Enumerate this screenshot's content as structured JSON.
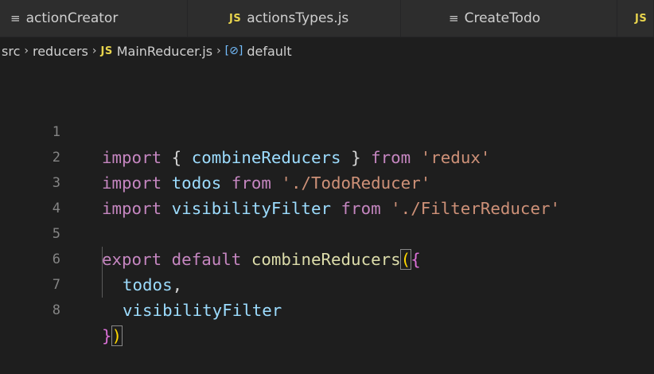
{
  "tabs": [
    {
      "icon": "≡",
      "label": "actionCreator"
    },
    {
      "icon": "JS",
      "label": "actionsTypes.js"
    },
    {
      "icon": "≡",
      "label": "CreateTodo"
    },
    {
      "icon": "JS",
      "label": ""
    }
  ],
  "breadcrumb": {
    "folder1": "src",
    "folder2": "reducers",
    "file_icon": "JS",
    "file": "MainReducer.js",
    "symbol_icon": "[⊘]",
    "symbol": "default",
    "separator": "›"
  },
  "editor": {
    "line_numbers": [
      "1",
      "2",
      "3",
      "4",
      "5",
      "6",
      "7",
      "8"
    ],
    "tokens": {
      "import": "import",
      "from": "from",
      "export": "export",
      "default": "default",
      "combineReducers": "combineReducers",
      "todos": "todos",
      "visibilityFilter": "visibilityFilter",
      "redux": "'redux'",
      "todoReducerPath": "'./TodoReducer'",
      "filterReducerPath": "'./FilterReducer'",
      "openBrace": "{",
      "closeBrace": "}",
      "openParen": "(",
      "closeParen": ")",
      "comma": ","
    }
  }
}
